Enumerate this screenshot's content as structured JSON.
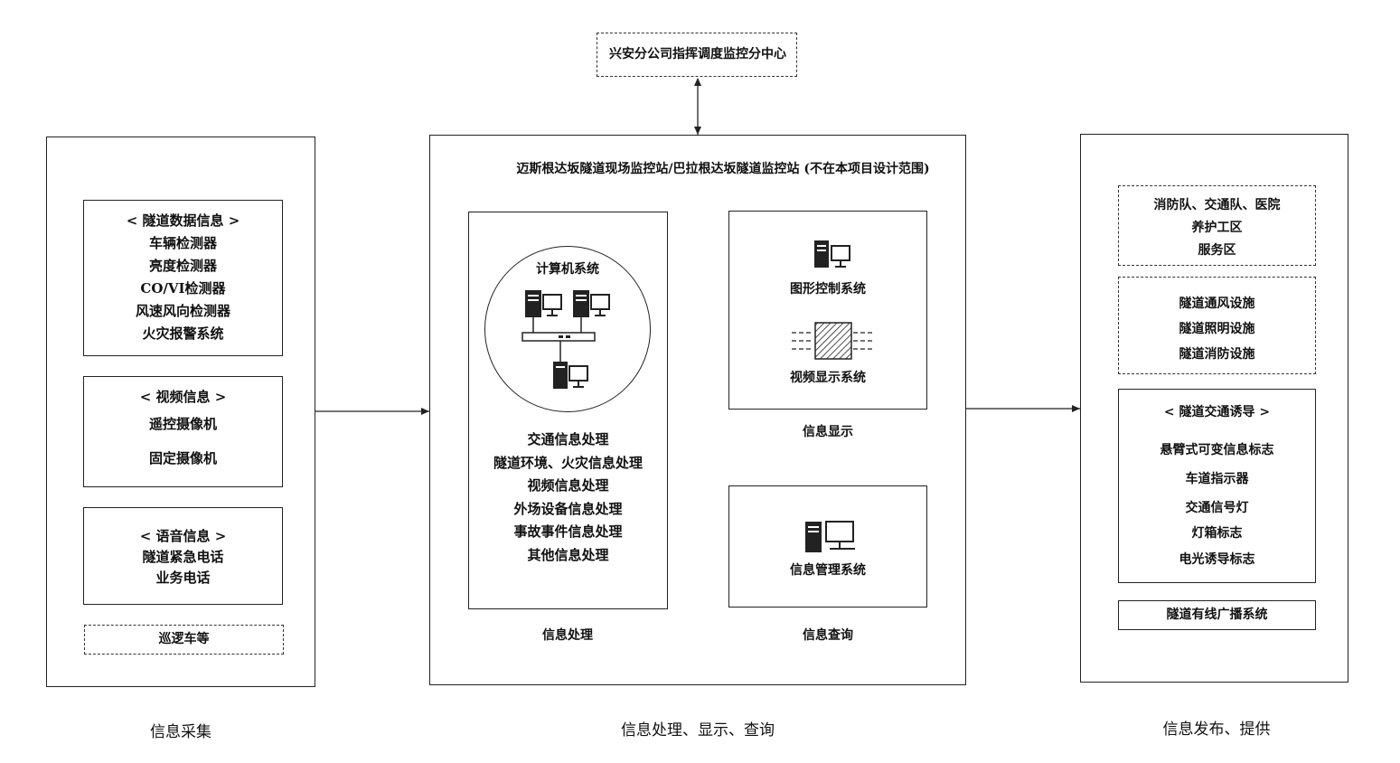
{
  "top": {
    "title": "兴安分公司指挥调度监控分中心"
  },
  "left": {
    "caption": "信息采集",
    "tunnel_data": [
      "< 隧道数据信息 >",
      "车辆检测器",
      "亮度检测器",
      "CO/VI检测器",
      "风速风向检测器",
      "火灾报警系统"
    ],
    "video": [
      "< 视频信息 >",
      "遥控摄像机",
      "固定摄像机"
    ],
    "voice": [
      "< 语音信息 >",
      "隧道紧急电话",
      "业务电话"
    ],
    "patrol": "巡逻车等"
  },
  "center": {
    "caption": "信息处理、显示、查询",
    "header": "迈斯根达坂隧道现场监控站/巴拉根达坂隧道监控站 (不在本项目设计范围)",
    "computer_system": "计算机系统",
    "processing_items": [
      "交通信息处理",
      "隧道环境、火灾信息处理",
      "视频信息处理",
      "外场设备信息处理",
      "事故事件信息处理",
      "其他信息处理"
    ],
    "processing_caption": "信息处理",
    "graphic_control": "图形控制系统",
    "video_display": "视频显示系统",
    "display_caption": "信息显示",
    "info_management": "信息管理系统",
    "query_caption": "信息查询"
  },
  "right": {
    "caption": "信息发布、提供",
    "agencies": [
      "消防队、交通队、医院",
      "养护工区",
      "服务区"
    ],
    "facilities": [
      "隧道通风设施",
      "隧道照明设施",
      "隧道消防设施"
    ],
    "guidance": [
      "< 隧道交通诱导 >",
      "悬臂式可变信息标志",
      "车道指示器",
      "交通信号灯",
      "灯箱标志",
      "电光诱导标志"
    ],
    "broadcast": "隧道有线广播系统"
  }
}
